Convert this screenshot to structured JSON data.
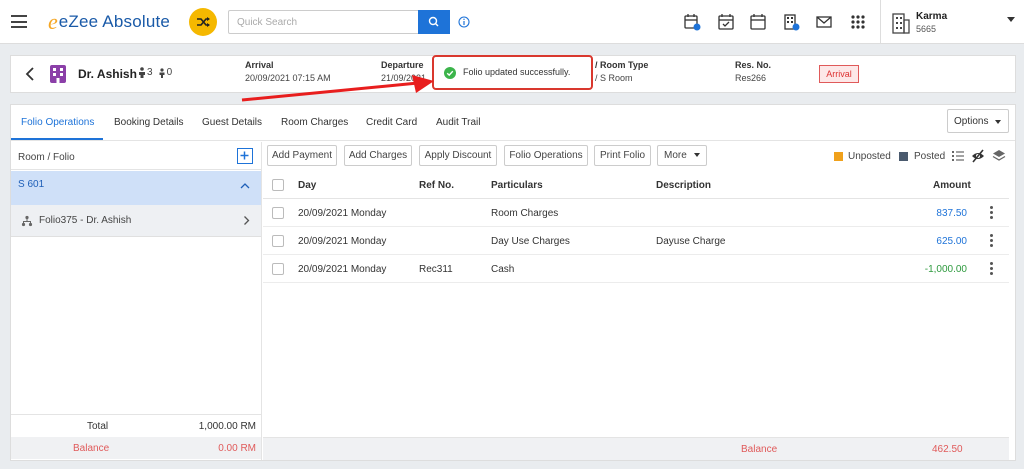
{
  "app": {
    "brand": "eZee Absolute",
    "brand_mark": "e",
    "accent": "#1e73d8",
    "brand_color": "#1a5aa8",
    "shuffle_color": "#f5b800"
  },
  "search": {
    "placeholder": "Quick Search"
  },
  "toolbar_icons": [
    "calendar-add-icon",
    "calendar-check-icon",
    "calendar-icon",
    "reservation-building-icon",
    "mail-icon",
    "apps-grid-icon"
  ],
  "hotel": {
    "name": "Karma",
    "code": "5665"
  },
  "reservation": {
    "guest_name": "Dr. Ashish",
    "adults": "3",
    "children": "0",
    "arrival_label": "Arrival",
    "arrival_value": "20/09/2021 07:15 AM",
    "departure_label": "Departure",
    "departure_value": "21/09/2021",
    "room_type_label": "/ Room Type",
    "room_type_value": "/ S Room",
    "res_no_label": "Res. No.",
    "res_no_value": "Res266",
    "status_badge": "Arrival"
  },
  "toast": {
    "message": "Folio updated successfully.",
    "color": "#3cb44b"
  },
  "tabs": [
    {
      "label": "Folio Operations",
      "active": true
    },
    {
      "label": "Booking Details"
    },
    {
      "label": "Guest Details"
    },
    {
      "label": "Room Charges"
    },
    {
      "label": "Credit Card"
    },
    {
      "label": "Audit Trail"
    }
  ],
  "options_label": "Options",
  "left_panel": {
    "header": "Room / Folio",
    "room": "S 601",
    "folio": "Folio375 - Dr. Ashish",
    "total_label": "Total",
    "total_value": "1,000.00 RM",
    "balance_label": "Balance",
    "balance_value": "0.00 RM"
  },
  "actions": [
    "Add Payment",
    "Add Charges",
    "Apply Discount",
    "Folio Operations",
    "Print Folio",
    "More"
  ],
  "legend": {
    "unposted": "Unposted",
    "unposted_color": "#f0a11b",
    "posted": "Posted",
    "posted_color": "#4a5a6e"
  },
  "table": {
    "headers": {
      "day": "Day",
      "ref": "Ref No.",
      "particulars": "Particulars",
      "description": "Description",
      "amount": "Amount"
    },
    "rows": [
      {
        "day": "20/09/2021 Monday",
        "ref": "",
        "particulars": "Room Charges",
        "description": "",
        "amount": "837.50",
        "amount_color": "#1e73d8"
      },
      {
        "day": "20/09/2021 Monday",
        "ref": "",
        "particulars": "Day Use Charges",
        "description": "Dayuse Charge",
        "amount": "625.00",
        "amount_color": "#1e73d8"
      },
      {
        "day": "20/09/2021 Monday",
        "ref": "Rec311",
        "particulars": "Cash",
        "description": "",
        "amount": "-1,000.00",
        "amount_color": "#2e9a3e"
      }
    ]
  },
  "balance": {
    "label": "Balance",
    "value": "462.50"
  }
}
